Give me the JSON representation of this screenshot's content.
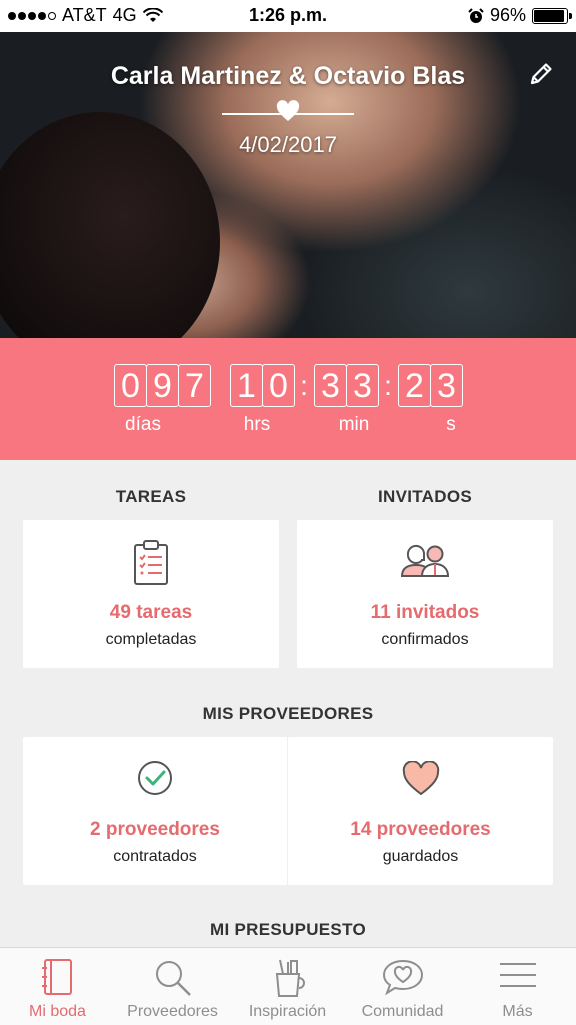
{
  "status_bar": {
    "carrier": "AT&T",
    "network": "4G",
    "time": "1:26 p.m.",
    "battery": "96%",
    "battery_level": 0.96
  },
  "hero": {
    "couple_names": "Carla Martinez & Octavio Blas",
    "wedding_date": "4/02/2017"
  },
  "countdown": {
    "days": [
      "0",
      "9",
      "7"
    ],
    "hours": [
      "1",
      "0"
    ],
    "minutes": [
      "3",
      "3"
    ],
    "seconds": [
      "2",
      "3"
    ],
    "labels": {
      "days": "días",
      "hours": "hrs",
      "minutes": "min",
      "seconds": "s"
    }
  },
  "tasks": {
    "section_title": "TAREAS",
    "count": "49 tareas",
    "caption": "completadas"
  },
  "guests": {
    "section_title": "INVITADOS",
    "count": "11 invitados",
    "caption": "confirmados"
  },
  "vendors": {
    "section_title": "MIS PROVEEDORES",
    "hired": {
      "count": "2 proveedores",
      "caption": "contratados"
    },
    "saved": {
      "count": "14 proveedores",
      "caption": "guardados"
    }
  },
  "budget": {
    "section_title": "MI PRESUPUESTO"
  },
  "tab_bar": {
    "items": [
      {
        "label": "Mi boda",
        "icon": "notebook-icon",
        "active": true
      },
      {
        "label": "Proveedores",
        "icon": "search-icon",
        "active": false
      },
      {
        "label": "Inspiración",
        "icon": "inspiration-cup-icon",
        "active": false
      },
      {
        "label": "Comunidad",
        "icon": "chat-heart-icon",
        "active": false
      },
      {
        "label": "Más",
        "icon": "menu-icon",
        "active": false
      }
    ]
  },
  "colors": {
    "accent": "#f7767f",
    "accent_text": "#e56b6f",
    "background": "#efefef"
  }
}
